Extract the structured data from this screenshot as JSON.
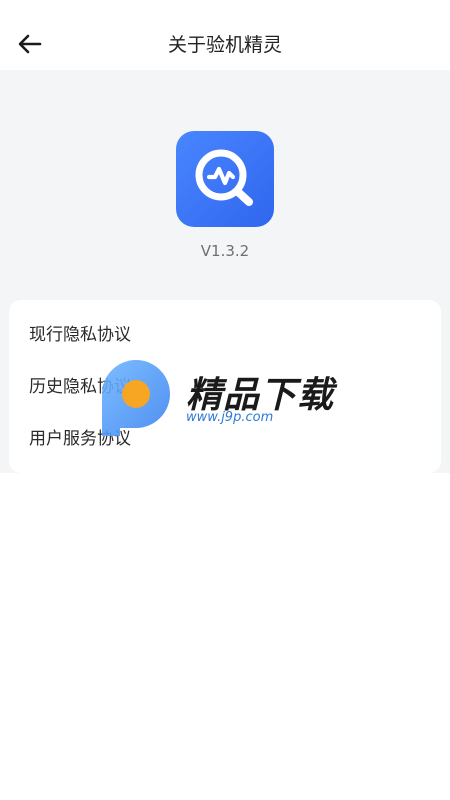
{
  "header": {
    "title": "关于验机精灵",
    "back_icon": "arrow-left-icon"
  },
  "app": {
    "icon": "magnifier-pulse-icon",
    "version": "V1.3.2"
  },
  "menu": {
    "items": [
      {
        "label": "现行隐私协议"
      },
      {
        "label": "历史隐私协议"
      },
      {
        "label": "用户服务协议"
      }
    ]
  },
  "watermark": {
    "title": "精品下载",
    "url": "www.j9p.com"
  },
  "colors": {
    "accent": "#3A74F5",
    "background": "#F4F5F7",
    "card": "#FFFFFF"
  }
}
